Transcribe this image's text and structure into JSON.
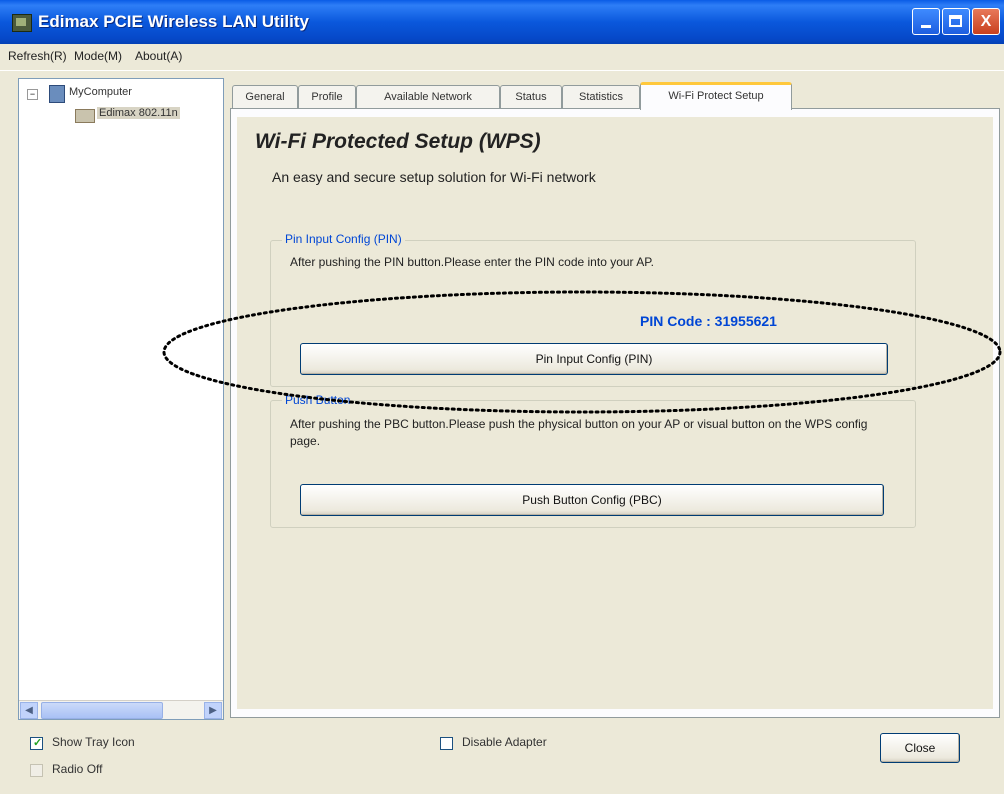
{
  "window": {
    "title": "Edimax PCIE Wireless LAN Utility",
    "close_glyph": "X"
  },
  "menu": {
    "items": [
      "Refresh(R)",
      "Mode(M)",
      "About(A)"
    ]
  },
  "tree": {
    "expand_glyph": "−",
    "root_label": "MyComputer",
    "device_label": "Edimax 802.11n",
    "scroll_left": "◀",
    "scroll_right": "▶"
  },
  "tabs": [
    {
      "label": "General"
    },
    {
      "label": "Profile"
    },
    {
      "label": "Available Network"
    },
    {
      "label": "Status"
    },
    {
      "label": "Statistics"
    },
    {
      "label": "Wi-Fi Protect Setup"
    }
  ],
  "active_tab": 5,
  "wps": {
    "title": "Wi-Fi Protected Setup (WPS)",
    "subtitle": "An easy and secure setup solution for Wi-Fi network",
    "pin_group": {
      "legend": "Pin Input Config (PIN)",
      "description": "After pushing the PIN button.Please enter the PIN code into your AP.",
      "pin_code_label": "PIN Code :",
      "pin_code_value": "31955621",
      "button": "Pin Input Config (PIN)"
    },
    "pbc_group": {
      "legend": "Push Button",
      "description": "After pushing the PBC button.Please push the physical button on your AP or visual button on the WPS config page.",
      "button": "Push Button Config (PBC)"
    }
  },
  "bottom": {
    "show_tray_icon": {
      "label": "Show Tray Icon",
      "checked": true
    },
    "radio_off": {
      "label": "Radio Off",
      "checked": false
    },
    "disable_adapter": {
      "label": "Disable Adapter",
      "checked": false
    },
    "check_glyph": "✓",
    "close_button": "Close"
  },
  "colors": {
    "accent": "#0046d5",
    "titlebar": "#0a58dc",
    "tab_highlight": "#ffc83c"
  }
}
